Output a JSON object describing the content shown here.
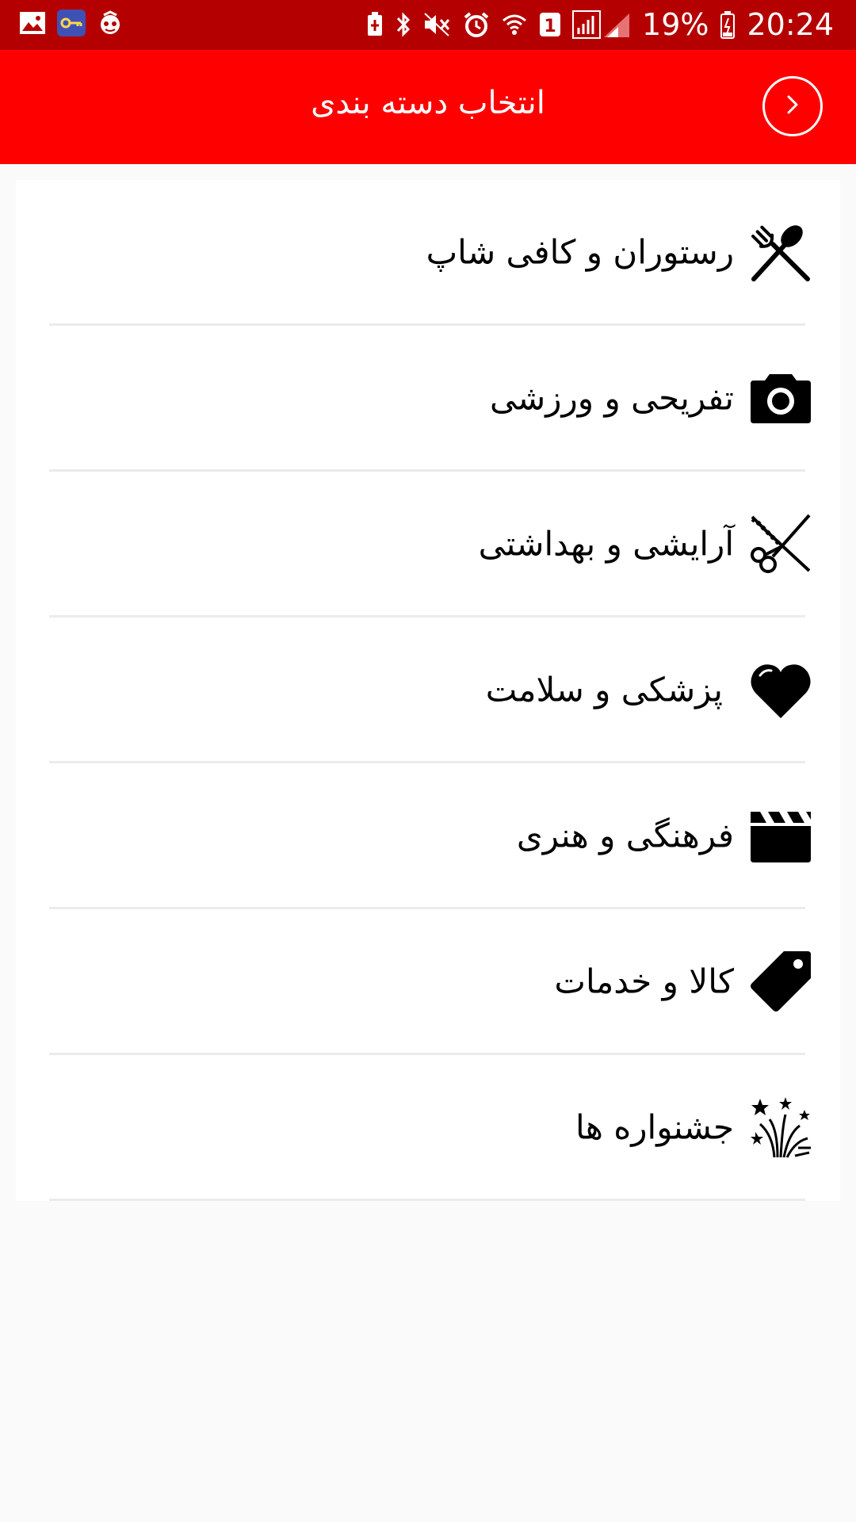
{
  "status_bar": {
    "time": "20:24",
    "battery": "19%",
    "sim_slot": "1",
    "icons": [
      "gallery-icon",
      "key-icon",
      "app-icon",
      "battery-saver-icon",
      "bluetooth-icon",
      "mute-icon",
      "alarm-icon",
      "wifi-icon",
      "signal-icon",
      "battery-icon"
    ]
  },
  "header": {
    "title": "انتخاب دسته بندی",
    "back_icon": "chevron-right-icon"
  },
  "categories": [
    {
      "label": "رستوران و کافی شاپ",
      "icon": "fork-spoon-icon"
    },
    {
      "label": "تفریحی و ورزشی",
      "icon": "camera-icon"
    },
    {
      "label": "آرایشی و بهداشتی",
      "icon": "scissors-comb-icon"
    },
    {
      "label": "پزشکی و سلامت",
      "icon": "heart-icon"
    },
    {
      "label": "فرهنگی و هنری",
      "icon": "clapperboard-icon"
    },
    {
      "label": "کالا و خدمات",
      "icon": "tag-icon"
    },
    {
      "label": "جشنواره ها",
      "icon": "fireworks-icon"
    }
  ],
  "colors": {
    "status_bar": "#b50000",
    "app_bar": "#ff0000",
    "background": "#fafafa",
    "card": "#ffffff",
    "divider": "#ebebeb"
  }
}
